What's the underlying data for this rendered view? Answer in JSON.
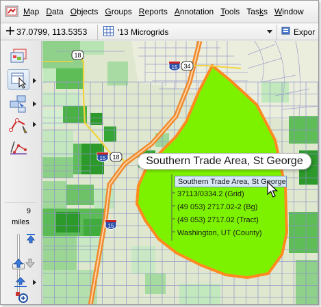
{
  "menu": {
    "items": [
      {
        "label": "Map",
        "key": "M"
      },
      {
        "label": "Data",
        "key": "D"
      },
      {
        "label": "Objects",
        "key": "O"
      },
      {
        "label": "Groups",
        "key": "G"
      },
      {
        "label": "Reports",
        "key": "R"
      },
      {
        "label": "Annotation",
        "key": "A"
      },
      {
        "label": "Tools",
        "key": "T"
      },
      {
        "label": "Tasks",
        "key": "k"
      },
      {
        "label": "Window",
        "key": "W"
      }
    ]
  },
  "toolbar": {
    "coordinates": "37.0799, 113.5353",
    "layer_name": "'13 Microgrids",
    "export_label": "Expor"
  },
  "palette": {
    "zoom_value": "9",
    "zoom_unit": "miles"
  },
  "map": {
    "highway_labels": [
      "18",
      "15",
      "34",
      "15",
      "18",
      "15"
    ],
    "trade_area_label": "Southern Trade Area, St George",
    "info_popup": {
      "title": "Southern Trade Area, St George",
      "rows": [
        "37113/0334.2 (Grid)",
        "(49 053) 2717.02-2 (Bg)",
        "(49 053) 2717.02 (Tract)",
        "Washington, UT (County)"
      ]
    },
    "colors": {
      "trade_area_fill": "#7df200",
      "trade_area_border": "#ff8a1f",
      "grid_lines": "#8d8fc8",
      "highway": "#f08a2c",
      "background": "#dfe8cf"
    }
  }
}
